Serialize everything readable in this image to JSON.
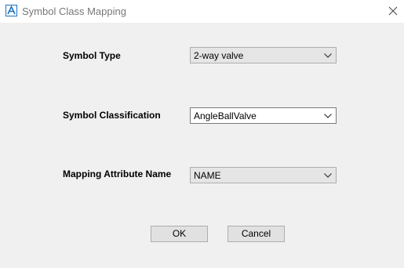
{
  "window": {
    "title": "Symbol Class Mapping"
  },
  "form": {
    "symbol_type": {
      "label": "Symbol Type",
      "value": "2-way valve"
    },
    "symbol_classification": {
      "label": "Symbol Classification",
      "value": "AngleBallValve"
    },
    "mapping_attribute": {
      "label": "Mapping Attribute Name",
      "value": "NAME"
    }
  },
  "buttons": {
    "ok_label": "OK",
    "cancel_label": "Cancel"
  },
  "icons": {
    "app": "autodesk-a-icon",
    "close": "close-icon",
    "dropdown": "chevron-down-icon"
  },
  "colors": {
    "accent": "#1e73be",
    "background": "#f0f0f0",
    "titlebar": "#ffffff"
  }
}
